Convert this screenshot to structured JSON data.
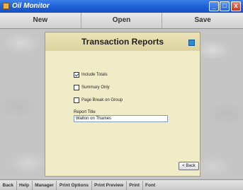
{
  "window": {
    "title": "Oil Monitor",
    "min_label": "_",
    "max_label": "□",
    "close_label": "x"
  },
  "toolbar": {
    "new_label": "New",
    "open_label": "Open",
    "save_label": "Save"
  },
  "panel": {
    "title": "Transaction Reports",
    "options": [
      {
        "label": "Include Totals",
        "checked": true
      },
      {
        "label": "Summary Only",
        "checked": false
      },
      {
        "label": "Page Break on Group",
        "checked": false
      }
    ],
    "report_title_label": "Report Title",
    "report_title_value": "Walton on Thames",
    "back_label": "< Back"
  },
  "bottom_toolbar": {
    "items": [
      "Back",
      "Help",
      "Manager",
      "Print Options",
      "Print Preview",
      "Print",
      "Font"
    ]
  },
  "colors": {
    "title_bar": "#1d5fd6",
    "panel_bg": "#f1ecc8",
    "stone_bg": "#c5c5c5"
  }
}
